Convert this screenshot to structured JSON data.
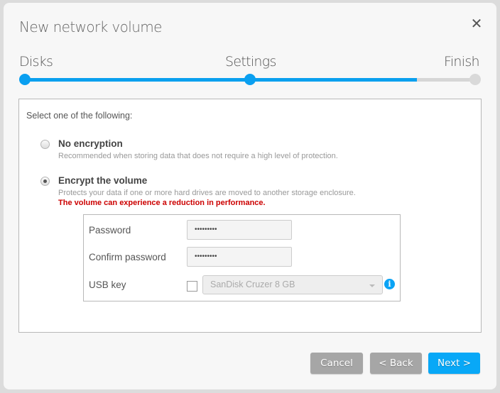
{
  "dialog": {
    "title": "New network volume",
    "close_icon": "close-icon"
  },
  "wizard": {
    "steps": [
      {
        "label": "Disks",
        "state": "done"
      },
      {
        "label": "Settings",
        "state": "current"
      },
      {
        "label": "Finish",
        "state": "todo"
      }
    ],
    "progress_fraction": 0.87,
    "colors": {
      "active": "#0aa0ee",
      "inactive": "#d6d6d6"
    }
  },
  "encryption": {
    "prompt": "Select one of the following:",
    "options": [
      {
        "title": "No encryption",
        "description": "Recommended when storing data that does not require a high level of protection.",
        "selected": false
      },
      {
        "title": "Encrypt the volume",
        "description": "Protects your data if one or more hard drives are moved to another storage enclosure.",
        "warning": "The volume can experience a reduction in performance.",
        "selected": true
      }
    ],
    "fields": {
      "password_label": "Password",
      "password_value": "•••••••••",
      "confirm_label": "Confirm password",
      "confirm_value": "•••••••••",
      "usb_label": "USB key",
      "usb_checked": false,
      "usb_selected": "SanDisk Cruzer 8 GB",
      "info_icon": "i"
    }
  },
  "footer": {
    "cancel_label": "Cancel",
    "back_label": "< Back",
    "next_label": "Next >"
  }
}
